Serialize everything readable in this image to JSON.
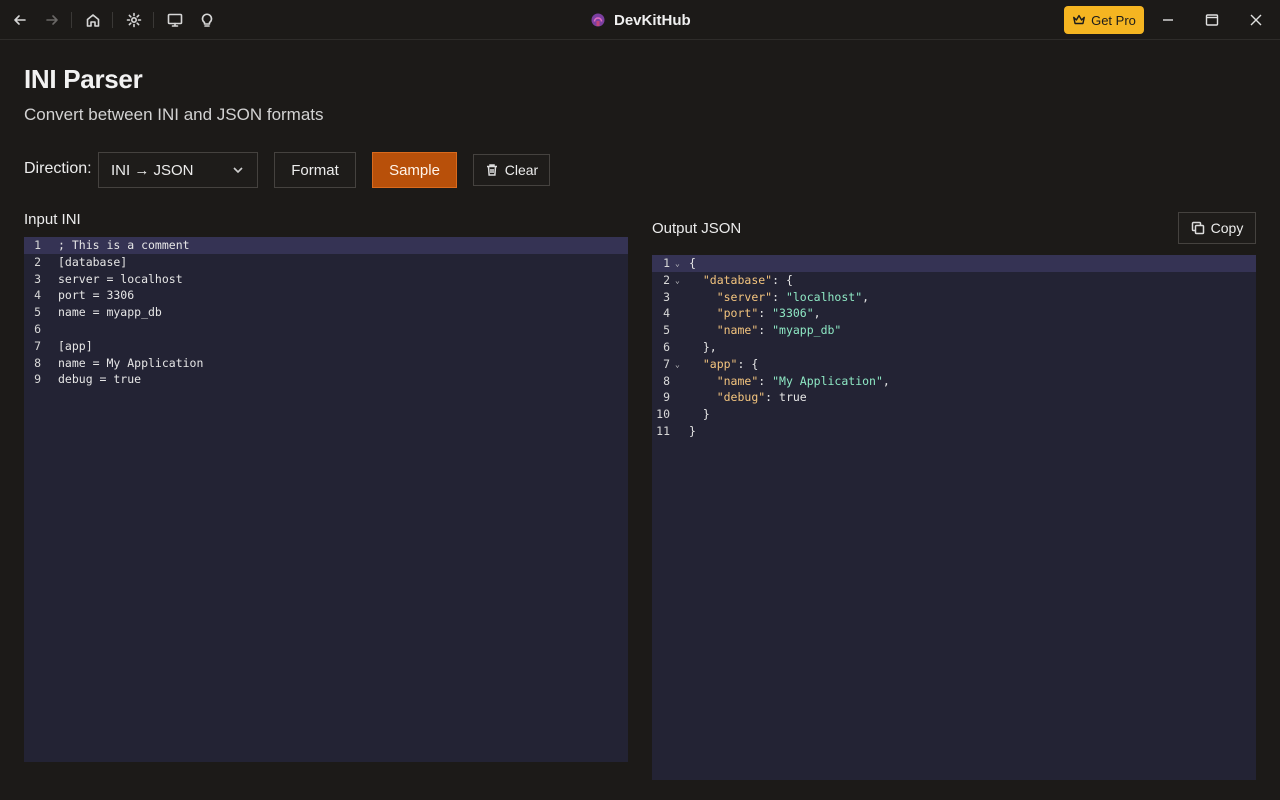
{
  "app": {
    "title": "DevKitHub",
    "get_pro": "Get Pro"
  },
  "nav": {
    "icons": [
      "back-arrow-icon",
      "forward-arrow-icon",
      "home-icon",
      "gear-icon",
      "monitor-icon",
      "lightbulb-icon"
    ]
  },
  "window_controls": [
    "minimize-icon",
    "maximize-icon",
    "close-icon"
  ],
  "colors": {
    "accent": "#b8500a",
    "pro": "#f5b521",
    "editor_bg": "#232334",
    "key": "#f3c47e",
    "string": "#8ee8c4"
  },
  "page": {
    "title": "INI Parser",
    "subtitle": "Convert between INI and JSON formats"
  },
  "controls": {
    "direction_label": "Direction:",
    "direction_value": "INI → JSON",
    "format": "Format",
    "sample": "Sample",
    "clear": "Clear"
  },
  "input": {
    "label": "Input INI",
    "lines": [
      "; This is a comment",
      "[database]",
      "server = localhost",
      "port = 3306",
      "name = myapp_db",
      "",
      "[app]",
      "name = My Application",
      "debug = true"
    ]
  },
  "output": {
    "label": "Output JSON",
    "copy": "Copy",
    "line_numbers": [
      "1",
      "2",
      "3",
      "4",
      "5",
      "6",
      "7",
      "8",
      "9",
      "10",
      "11"
    ]
  }
}
